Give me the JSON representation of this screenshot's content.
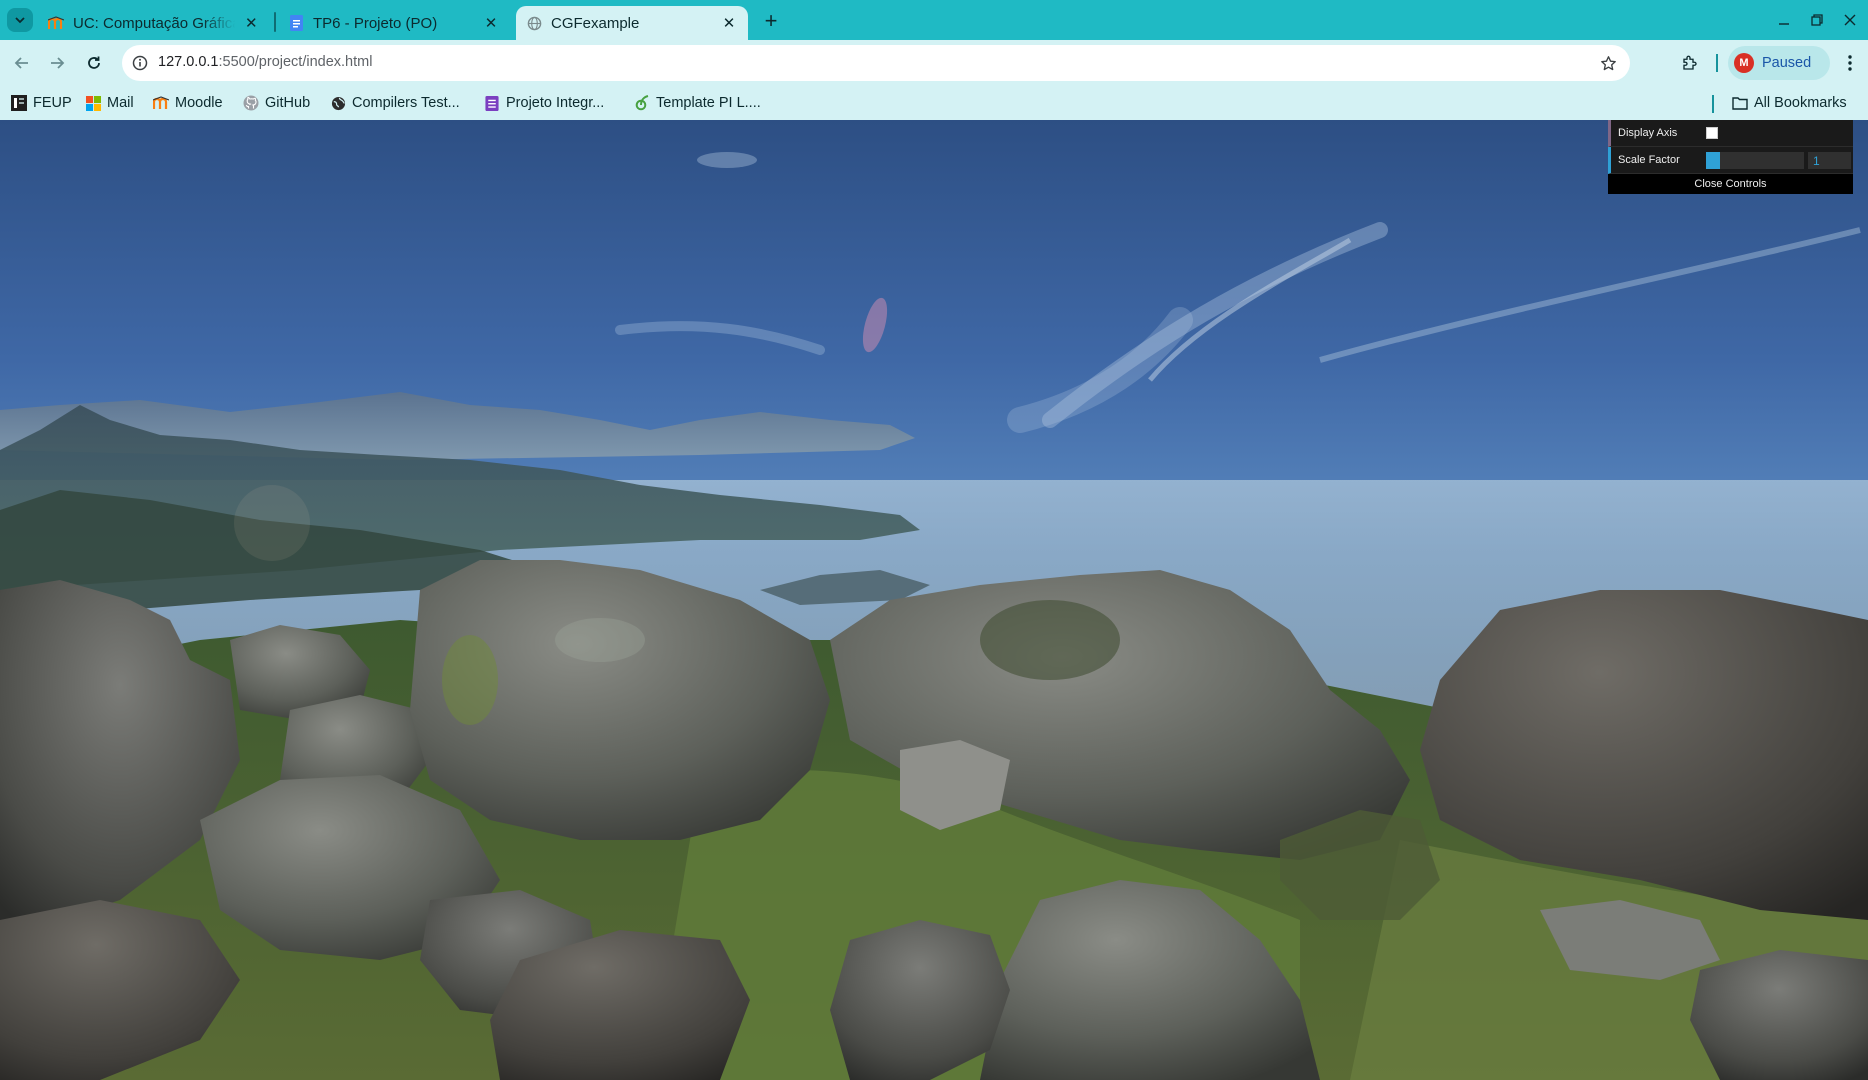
{
  "tabs": [
    {
      "title": "UC: Computação Gráfica",
      "icon": "moodle-icon",
      "active": false
    },
    {
      "title": "TP6 - Projeto (PO)",
      "icon": "docs-icon",
      "active": false
    },
    {
      "title": "CGFexample",
      "icon": "globe-icon",
      "active": true
    }
  ],
  "toolbar": {
    "url_host": "127.0.0.1",
    "url_path": ":5500/project/index.html",
    "profile_initial": "M",
    "profile_status": "Paused"
  },
  "bookmarks": [
    {
      "label": "FEUP",
      "icon": "feup-icon"
    },
    {
      "label": "Mail",
      "icon": "microsoft-icon"
    },
    {
      "label": "Moodle",
      "icon": "moodle-icon"
    },
    {
      "label": "GitHub",
      "icon": "github-icon"
    },
    {
      "label": "Compilers Test...",
      "icon": "globe-icon"
    },
    {
      "label": "Projeto Integr...",
      "icon": "list-icon"
    },
    {
      "label": "Template PI L....",
      "icon": "overleaf-icon"
    }
  ],
  "all_bookmarks": "All Bookmarks",
  "gui": {
    "display_axis_label": "Display Axis",
    "display_axis_checked": false,
    "scale_factor_label": "Scale Factor",
    "scale_factor_value": "1",
    "scale_factor_fraction": 0.14,
    "close_label": "Close Controls"
  },
  "colors": {
    "tab_strip": "#1fbac4",
    "toolbar": "#d4f2f4",
    "gui_accent": "#2fa1d6",
    "gui_bool_accent": "#806787"
  }
}
